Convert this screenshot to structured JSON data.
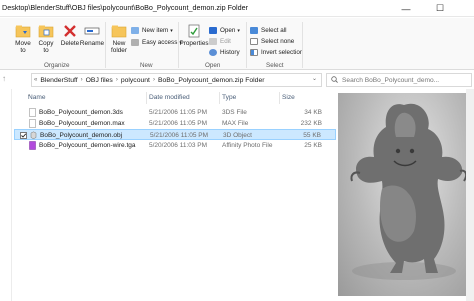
{
  "window": {
    "title": "Desktop\\BlenderStuff\\OBJ files\\polycount\\BoBo_Polycount_demon.zip Folder",
    "minimize": "—",
    "maximize": "☐"
  },
  "ribbon": {
    "organize": {
      "move_to": "Move to",
      "copy_to": "Copy to",
      "delete": "Delete",
      "rename": "Rename",
      "group_label": "Organize"
    },
    "new": {
      "new_folder": "New folder",
      "new_item": "New item",
      "easy_access": "Easy access",
      "group_label": "New"
    },
    "open": {
      "properties": "Properties",
      "open": "Open",
      "edit": "Edit",
      "history": "History",
      "group_label": "Open"
    },
    "select": {
      "select_all": "Select all",
      "select_none": "Select none",
      "invert_selection": "Invert selection",
      "group_label": "Select"
    }
  },
  "address": {
    "crumbs": [
      "BlenderStuff",
      "OBJ files",
      "polycount",
      "BoBo_Polycount_demon.zip Folder"
    ],
    "search_placeholder": "Search BoBo_Polycount_demo..."
  },
  "columns": [
    "Name",
    "Date modified",
    "Type",
    "Size"
  ],
  "files": [
    {
      "name": "BoBo_Polycount_demon.3ds",
      "date": "5/21/2006 11:05 PM",
      "type": "3DS File",
      "size": "34 KB",
      "icon": "file-icon",
      "selected": false
    },
    {
      "name": "BoBo_Polycount_demon.max",
      "date": "5/21/2006 11:05 PM",
      "type": "MAX File",
      "size": "232 KB",
      "icon": "file-icon",
      "selected": false
    },
    {
      "name": "BoBo_Polycount_demon.obj",
      "date": "5/21/2006 11:05 PM",
      "type": "3D Object",
      "size": "55 KB",
      "icon": "3d-object-icon",
      "selected": true
    },
    {
      "name": "BoBo_Polycount_demon-wire.tga",
      "date": "5/20/2006 11:03 PM",
      "type": "Affinity Photo File",
      "size": "25 KB",
      "icon": "image-file-icon",
      "selected": false
    }
  ],
  "colors": {
    "selection": "#cce8ff",
    "accent": "#0078d7"
  }
}
